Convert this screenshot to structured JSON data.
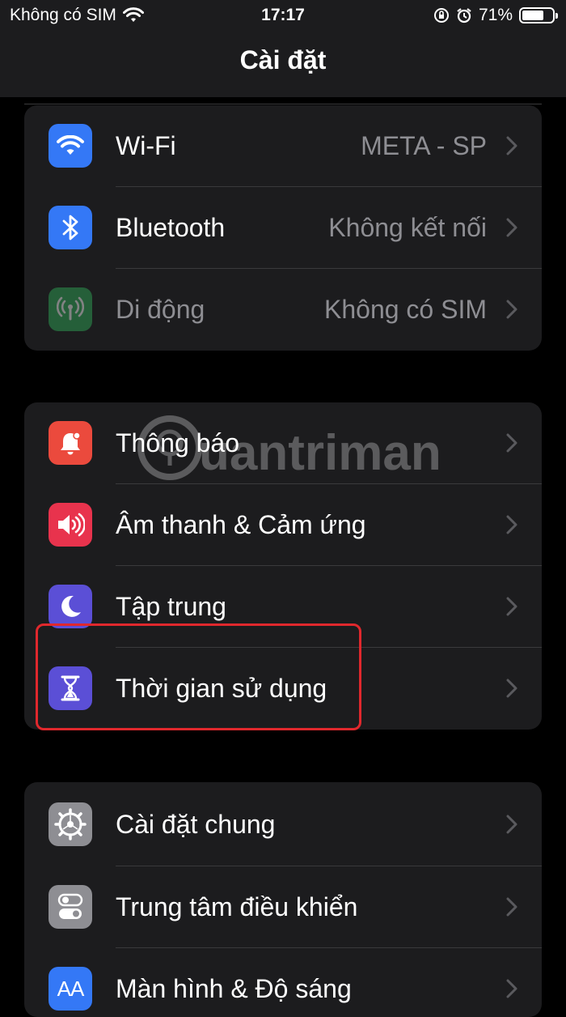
{
  "status_bar": {
    "carrier": "Không có SIM",
    "time": "17:17",
    "battery_percent": "71%",
    "battery_level": 0.71
  },
  "header": {
    "title": "Cài đặt"
  },
  "groups": [
    {
      "rows": [
        {
          "label": "Wi-Fi",
          "value": "META - SP",
          "icon": "wifi-icon",
          "color": "#3478f6"
        },
        {
          "label": "Bluetooth",
          "value": "Không kết nối",
          "icon": "bluetooth-icon",
          "color": "#3478f6"
        },
        {
          "label": "Di động",
          "value": "Không có SIM",
          "icon": "cellular-icon",
          "color": "#30b15a",
          "dimmed": true
        }
      ]
    },
    {
      "rows": [
        {
          "label": "Thông báo",
          "icon": "notification-bell-icon",
          "color": "#eb4a3d"
        },
        {
          "label": "Âm thanh & Cảm ứng",
          "icon": "speaker-icon",
          "color": "#e8334d"
        },
        {
          "label": "Tập trung",
          "icon": "moon-icon",
          "color": "#5b4fd6"
        },
        {
          "label": "Thời gian sử dụng",
          "icon": "hourglass-icon",
          "color": "#5b4fd6",
          "highlighted": true
        }
      ]
    },
    {
      "rows": [
        {
          "label": "Cài đặt chung",
          "icon": "gear-icon",
          "color": "#8e8e93"
        },
        {
          "label": "Trung tâm điều khiển",
          "icon": "toggle-switches-icon",
          "color": "#8e8e93"
        },
        {
          "label": "Màn hình & Độ sáng",
          "icon": "text-size-icon",
          "color": "#3478f6",
          "icon_text": "AA"
        }
      ]
    }
  ],
  "watermark": {
    "text": "uantrimang"
  },
  "colors": {
    "highlight_border": "#e0282d",
    "background": "#000000",
    "group_bg": "#1c1c1e"
  }
}
